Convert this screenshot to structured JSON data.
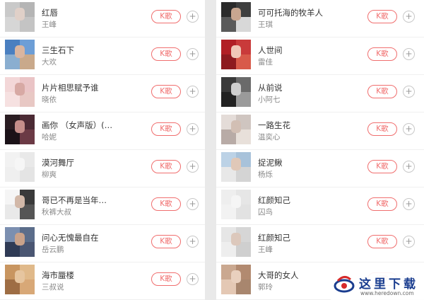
{
  "kge_label": "K歌",
  "plus_label": "+",
  "left_list": [
    {
      "title": "红唇",
      "artist": "王峰",
      "colors": [
        "#c9c9c9",
        "#b5b5b5",
        "#d6d6d6",
        "#c4c4c4",
        "#e0d0c8"
      ]
    },
    {
      "title": "三生石下",
      "artist": "大欢",
      "colors": [
        "#4a7fc0",
        "#6d9ed6",
        "#8aaed0",
        "#c9a98b",
        "#d9b5a0"
      ]
    },
    {
      "title": "片片相思赋予谁",
      "artist": "晓依",
      "colors": [
        "#f3d7d8",
        "#eac4c6",
        "#f6e1e1",
        "#e8c8c4",
        "#d7a9a4"
      ]
    },
    {
      "title": "画你 （女声版）(…",
      "artist": "哈妮",
      "colors": [
        "#2a1d22",
        "#4b2a34",
        "#1b1218",
        "#6b3a45",
        "#c48e8a"
      ]
    },
    {
      "title": "漠河舞厅",
      "artist": "柳爽",
      "colors": [
        "#f2f2f2",
        "#e9e9e9",
        "#efefef",
        "#e4e4e4",
        "#f6f6f6"
      ]
    },
    {
      "title": "哥已不再是当年…",
      "artist": "秋裤大叔",
      "colors": [
        "#f5f5f5",
        "#3a3a3a",
        "#e9e9e9",
        "#555555",
        "#d2b8a8"
      ]
    },
    {
      "title": "问心无愧最自在",
      "artist": "岳云鹏",
      "colors": [
        "#7b8fb0",
        "#5b6d8a",
        "#2f3b55",
        "#4a5672",
        "#c9a28a"
      ]
    },
    {
      "title": "海市蜃楼",
      "artist": "三叔说",
      "colors": [
        "#c89560",
        "#e0b98a",
        "#9e6d44",
        "#d8a877",
        "#e6c59f"
      ]
    }
  ],
  "right_list": [
    {
      "title": "可可托海的牧羊人",
      "artist": "王琪",
      "colors": [
        "#2b2b2b",
        "#3f3f3f",
        "#5a5a5a",
        "#d8d8d8",
        "#c8a690"
      ]
    },
    {
      "title": "人世间",
      "artist": "雷佳",
      "colors": [
        "#b11f25",
        "#c93a3a",
        "#8d1a1f",
        "#d85a4a",
        "#f0c8b8"
      ]
    },
    {
      "title": "从前说",
      "artist": "小阿七",
      "colors": [
        "#3a3a3a",
        "#6a6a6a",
        "#222222",
        "#9a9a9a",
        "#cfcfcf"
      ]
    },
    {
      "title": "一路生花",
      "artist": "温奕心",
      "colors": [
        "#e4dcd8",
        "#cfc5c0",
        "#b8aba6",
        "#e8e0da",
        "#d2bfb4"
      ]
    },
    {
      "title": "捉泥鳅",
      "artist": "杨烁",
      "colors": [
        "#bcd2e6",
        "#a8c2da",
        "#e8e8e8",
        "#d4d4d4",
        "#e0c8b8"
      ]
    },
    {
      "title": "红颜知己",
      "artist": "囚鸟",
      "colors": [
        "#eeeeee",
        "#e6e6e6",
        "#f2f2f2",
        "#e2e2e2",
        "#f5f5f5"
      ]
    },
    {
      "title": "红颜知己",
      "artist": "王峰",
      "colors": [
        "#e6e6e6",
        "#d6d6d6",
        "#eeeeee",
        "#cfcfcf",
        "#dcc8bc"
      ]
    },
    {
      "title": "大哥的女人",
      "artist": "郭玲",
      "colors": [
        "#caa890",
        "#b28a70",
        "#e4c8b4",
        "#a8866e",
        "#e9d0be"
      ]
    }
  ],
  "watermark": {
    "text": "这里下载",
    "url": "www.heredown.com",
    "colors": {
      "blue": "#1a3d8f",
      "red": "#d62a2a"
    }
  }
}
